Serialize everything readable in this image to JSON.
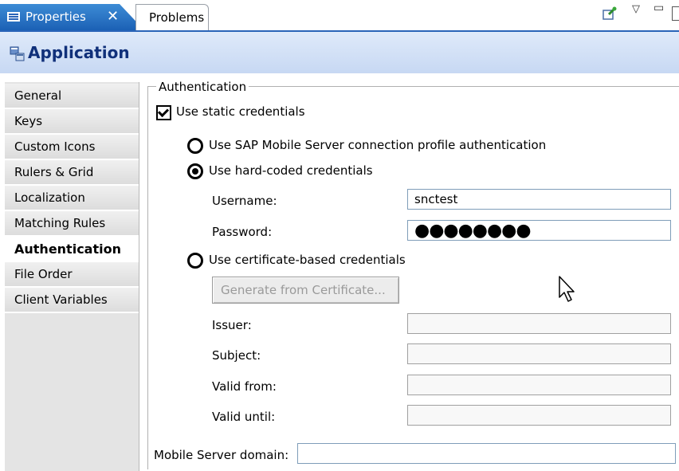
{
  "tabs": {
    "properties": "Properties",
    "problems": "Problems"
  },
  "header": {
    "title": "Application"
  },
  "sidebar": {
    "items": [
      {
        "label": "General"
      },
      {
        "label": "Keys"
      },
      {
        "label": "Custom Icons"
      },
      {
        "label": "Rulers & Grid"
      },
      {
        "label": "Localization"
      },
      {
        "label": "Matching Rules"
      },
      {
        "label": "Authentication",
        "active": true
      },
      {
        "label": "File Order"
      },
      {
        "label": "Client Variables"
      }
    ]
  },
  "auth": {
    "group_title": "Authentication",
    "use_static_label": "Use static credentials",
    "use_static_checked": true,
    "option_profile": "Use SAP Mobile Server connection profile authentication",
    "option_hardcoded": "Use hard-coded credentials",
    "option_certificate": "Use certificate-based credentials",
    "selected_option": "hardcoded",
    "username_label": "Username:",
    "username_value": "snctest",
    "password_label": "Password:",
    "password_value": "●●●●●●●●",
    "generate_button": "Generate from Certificate...",
    "issuer_label": "Issuer:",
    "subject_label": "Subject:",
    "valid_from_label": "Valid from:",
    "valid_until_label": "Valid until:",
    "domain_label": "Mobile Server domain:"
  },
  "colors": {
    "tab_active": "#1a5fb4",
    "header_bg": "#c7d8f3",
    "title_color": "#10307a"
  },
  "icons": {
    "properties_tab": "properties-icon",
    "close": "close-icon",
    "pin": "pin-icon",
    "view_menu": "chevron-down-icon",
    "minimize": "minimize-icon",
    "maximize": "maximize-icon",
    "application": "application-icon",
    "cursor": "mouse-pointer-icon"
  }
}
